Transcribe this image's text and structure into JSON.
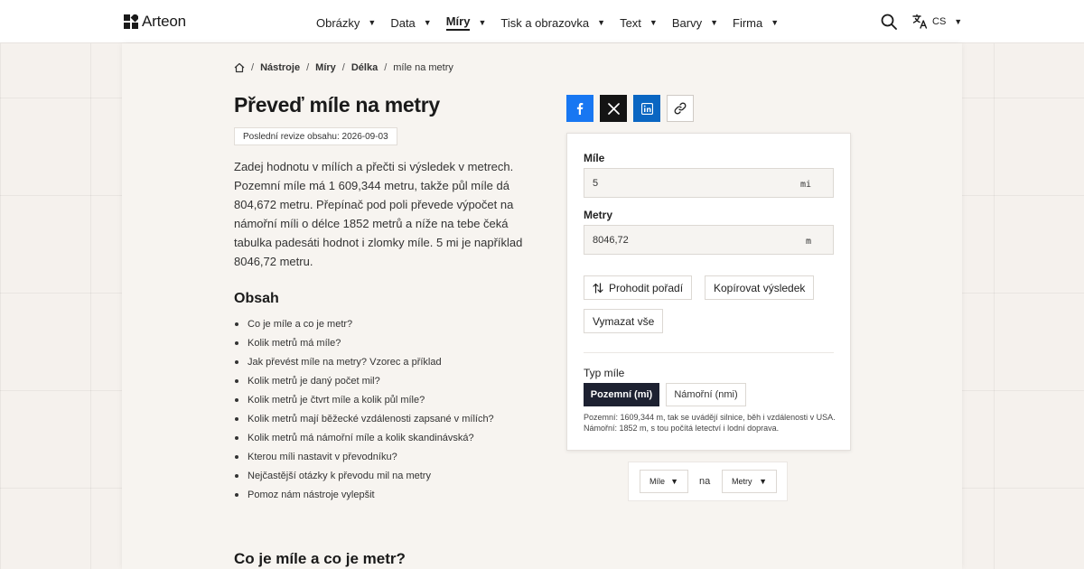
{
  "brand": {
    "name": "Arteon"
  },
  "nav": {
    "items": [
      {
        "label": "Obrázky"
      },
      {
        "label": "Data"
      },
      {
        "label": "Míry"
      },
      {
        "label": "Tisk a obrazovka"
      },
      {
        "label": "Text"
      },
      {
        "label": "Barvy"
      },
      {
        "label": "Firma"
      }
    ],
    "active": "Míry"
  },
  "language": {
    "code": "CS"
  },
  "breadcrumb": {
    "items": [
      "Nástroje",
      "Míry",
      "Délka"
    ],
    "current": "míle na metry"
  },
  "page": {
    "title": "Převeď míle na metry",
    "revision": "Poslední revize obsahu: 2026-09-03",
    "intro": "Zadej hodnotu v mílích a přečti si výsledek v metrech. Pozemní míle má 1 609,344 metru, takže půl míle dá 804,672 metru. Přepínač pod poli převede výpočet na námořní míli o délce 1852 metrů a níže na tebe čeká tabulka padesáti hodnot i zlomky míle. 5 mi je například 8046,72 metru."
  },
  "toc": {
    "title": "Obsah",
    "items": [
      "Co je míle a co je metr?",
      "Kolik metrů má míle?",
      "Jak převést míle na metry? Vzorec a příklad",
      "Kolik metrů je daný počet mil?",
      "Kolik metrů je čtvrt míle a kolik půl míle?",
      "Kolik metrů mají běžecké vzdálenosti zapsané v mílích?",
      "Kolik metrů má námořní míle a kolik skandinávská?",
      "Kterou míli nastavit v převodníku?",
      "Nejčastější otázky k převodu mil na metry",
      "Pomoz nám nástroje vylepšit"
    ]
  },
  "section": {
    "title": "Co je míle a co je metr?"
  },
  "converter": {
    "from": {
      "label": "Míle",
      "value": "5",
      "unit": "mi"
    },
    "to": {
      "label": "Metry",
      "value": "8046,72",
      "unit": "m"
    },
    "buttons": {
      "swap": "Prohodit pořadí",
      "copy": "Kopírovat výsledek",
      "clear": "Vymazat vše"
    },
    "mile_type": {
      "label": "Typ míle",
      "options": [
        "Pozemní (mi)",
        "Námořní (nmi)"
      ],
      "selected": "Pozemní (mi)",
      "note": "Pozemní: 1609,344 m, tak se uvádějí silnice, běh i vzdálenosti v USA. Námořní: 1852 m, s tou počítá letectví i lodní doprava."
    }
  },
  "unit_selector": {
    "from": "Míle",
    "joiner": "na",
    "to": "Metry"
  },
  "colors": {
    "accent_dark": "#1d2131",
    "facebook": "#1877f2",
    "x": "#141414",
    "linkedin": "#0a66c2",
    "background": "#f5f1ed"
  },
  "icons": {
    "search": "search-icon",
    "translate": "translate-icon",
    "home": "home-icon",
    "swap": "swap-icon",
    "share": [
      "facebook-icon",
      "x-icon",
      "linkedin-icon",
      "link-icon"
    ]
  }
}
